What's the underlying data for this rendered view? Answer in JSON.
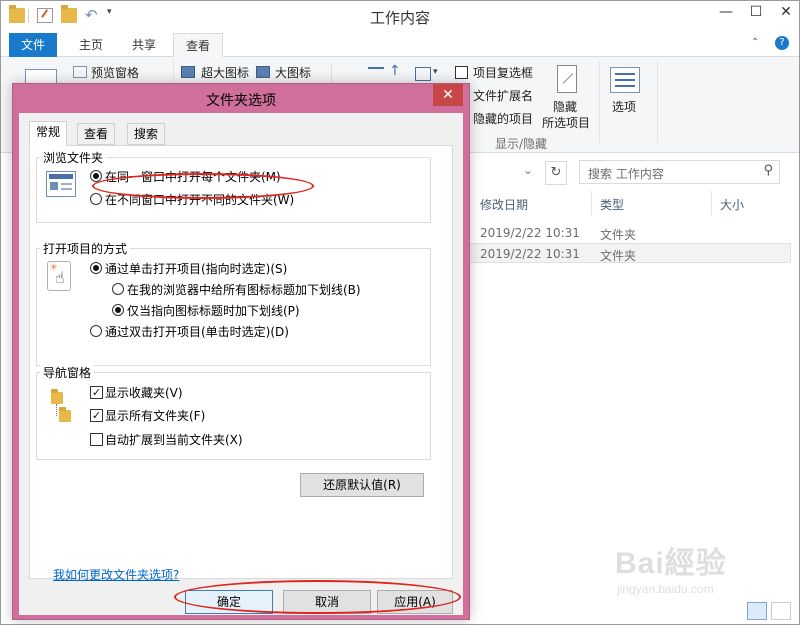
{
  "window": {
    "title": "工作内容",
    "minimize": "—",
    "maximize": "☐",
    "close": "✕"
  },
  "ribbon_tabs": {
    "file": "文件",
    "home": "主页",
    "share": "共享",
    "view": "查看"
  },
  "ribbon": {
    "preview_pane": "预览窗格",
    "extra_large_icons": "超大图标",
    "large_icons": "大图标",
    "item_checkboxes": "项目复选框",
    "file_extensions": "文件扩展名",
    "hidden_items": "隐藏的项目",
    "hide_selected_line1": "隐藏",
    "hide_selected_line2": "所选项目",
    "options": "选项",
    "show_hide_group": "显示/隐藏"
  },
  "search": {
    "placeholder": "搜索 工作内容"
  },
  "columns": {
    "date": "修改日期",
    "type": "类型",
    "size": "大小"
  },
  "rows": [
    {
      "date": "2019/2/22 10:31",
      "type": "文件夹"
    },
    {
      "date": "2019/2/22 10:31",
      "type": "文件夹"
    }
  ],
  "dialog": {
    "title": "文件夹选项",
    "close": "✕",
    "tabs": {
      "general": "常规",
      "view": "查看",
      "search": "搜索"
    },
    "browse": {
      "title": "浏览文件夹",
      "same_window": "在同一窗口中打开每个文件夹(M)",
      "new_window": "在不同窗口中打开不同的文件夹(W)",
      "selected": "same_window"
    },
    "click": {
      "title": "打开项目的方式",
      "single_click": "通过单击打开项目(指向时选定)(S)",
      "underline_browser": "在我的浏览器中给所有图标标题加下划线(B)",
      "underline_point": "仅当指向图标标题时加下划线(P)",
      "double_click": "通过双击打开项目(单击时选定)(D)"
    },
    "nav": {
      "title": "导航窗格",
      "show_favorites": "显示收藏夹(V)",
      "show_all_folders": "显示所有文件夹(F)",
      "auto_expand": "自动扩展到当前文件夹(X)",
      "favorites_checked": true,
      "all_folders_checked": true,
      "auto_expand_checked": false
    },
    "restore_defaults": "还原默认值(R)",
    "help_link": "我如何更改文件夹选项?",
    "ok": "确定",
    "cancel": "取消",
    "apply": "应用(A)"
  },
  "watermark": {
    "brand": "Bai經验",
    "url": "jingyan.baidu.com"
  },
  "colors": {
    "accent": "#1979ca",
    "dialog_frame": "#d06f9b",
    "highlight": "#e0241e",
    "link": "#0066cc"
  }
}
